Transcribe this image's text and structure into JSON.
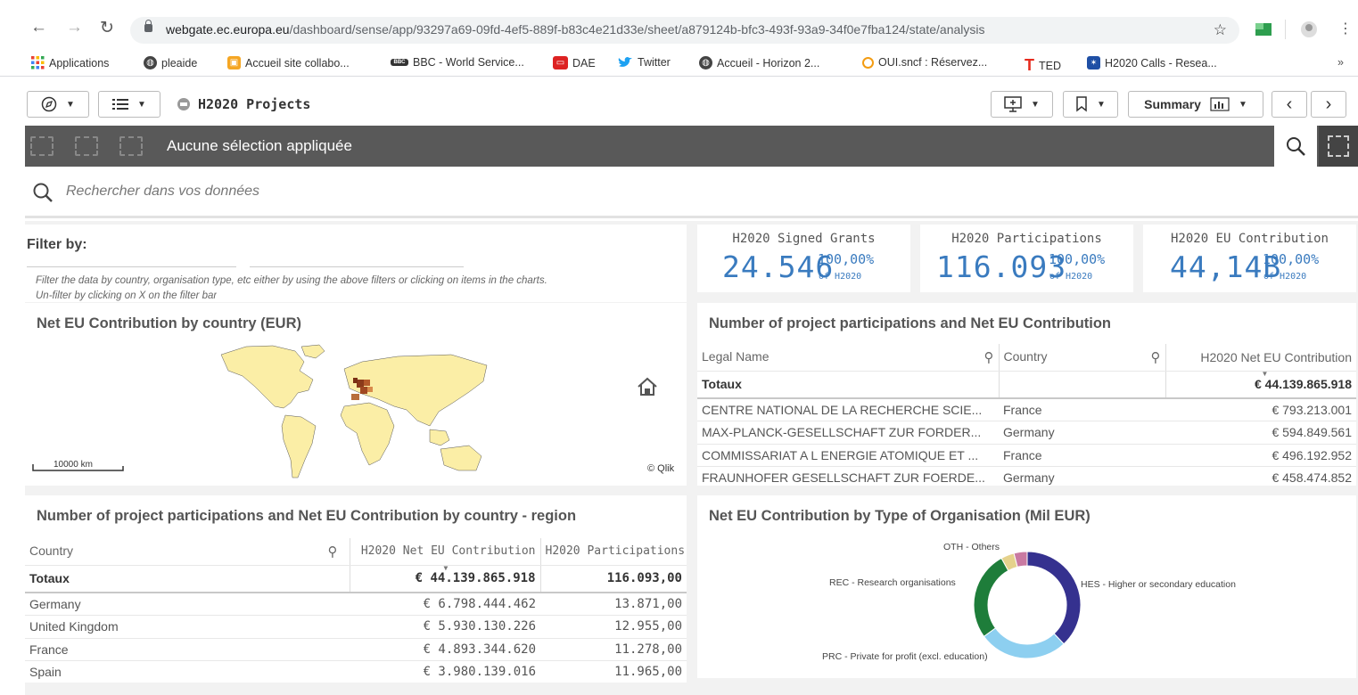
{
  "browser": {
    "url_domain": "webgate.ec.europa.eu",
    "url_path": "/dashboard/sense/app/93297a69-09fd-4ef5-889f-b83c4e21d33e/sheet/a879124b-bfc3-493f-93a9-34f0e7fba124/state/analysis",
    "bookmarks": [
      "Applications",
      "pleaide",
      "Accueil site collabo...",
      "BBC - World Service...",
      "DAE",
      "Twitter",
      "Accueil - Horizon 2...",
      "OUI.sncf : Réservez...",
      "TED",
      "H2020 Calls - Resea..."
    ],
    "bookmarks_more": "»"
  },
  "toolbar": {
    "app_title": "H2020 Projects",
    "sheet_label": "Summary"
  },
  "selections": {
    "text": "Aucune sélection appliquée"
  },
  "search": {
    "placeholder": "Rechercher dans vos données"
  },
  "filter": {
    "title": "Filter by:",
    "hint_line1": "Filter the data by country, organisation type, etc either by using the above filters or clicking on items in the charts.",
    "hint_line2": "Un-filter by clicking on X on the filter bar"
  },
  "kpis": [
    {
      "label": "H2020 Signed Grants",
      "value": "24.546",
      "pct": "100,00%",
      "of": "of H2020"
    },
    {
      "label": "H2020 Participations",
      "value": "116.093",
      "pct": "100,00%",
      "of": "of H2020"
    },
    {
      "label": "H2020 EU Contribution",
      "value": "44,14B",
      "pct": "100,00%",
      "of": "of H2020"
    }
  ],
  "map": {
    "title": "Net EU Contribution by country (EUR)",
    "scale": "10000 km",
    "credit": "© Qlik"
  },
  "participants_table": {
    "title": "Number of project participations and Net EU Contribution",
    "columns": [
      "Legal Name",
      "Country",
      "H2020 Net EU Contribution"
    ],
    "totals_label": "Totaux",
    "totals_value": "€ 44.139.865.918",
    "rows": [
      [
        "CENTRE NATIONAL DE LA RECHERCHE SCIE...",
        "France",
        "€ 793.213.001"
      ],
      [
        "MAX-PLANCK-GESELLSCHAFT ZUR FORDER...",
        "Germany",
        "€ 594.849.561"
      ],
      [
        "COMMISSARIAT A L ENERGIE ATOMIQUE ET ...",
        "France",
        "€ 496.192.952"
      ],
      [
        "FRAUNHOFER GESELLSCHAFT ZUR FOERDE...",
        "Germany",
        "€ 458.474.852"
      ]
    ]
  },
  "country_table": {
    "title": "Number of project participations and Net EU Contribution by country - region",
    "columns": [
      "Country",
      "H2020 Net EU Contribution",
      "H2020 Participations"
    ],
    "totals_label": "Totaux",
    "totals_contribution": "€ 44.139.865.918",
    "totals_participations": "116.093,00",
    "rows": [
      [
        "Germany",
        "€ 6.798.444.462",
        "13.871,00"
      ],
      [
        "United Kingdom",
        "€ 5.930.130.226",
        "12.955,00"
      ],
      [
        "France",
        "€ 4.893.344.620",
        "11.278,00"
      ],
      [
        "Spain",
        "€ 3.980.139.016",
        "11.965,00"
      ]
    ]
  },
  "chart_data": {
    "type": "pie",
    "title": "Net EU Contribution by Type of Organisation (Mil EUR)",
    "donut": true,
    "slices": [
      {
        "label": "HES - Higher or secondary education",
        "value": 38,
        "color": "#35318f"
      },
      {
        "label": "PRC - Private for profit (excl. education)",
        "value": 27,
        "color": "#8dcff0"
      },
      {
        "label": "REC - Research organisations",
        "value": 27,
        "color": "#1e7d3a"
      },
      {
        "label": "",
        "value": 4,
        "color": "#e5d28c"
      },
      {
        "label": "OTH - Others",
        "value": 4,
        "color": "#c97aa2"
      }
    ]
  }
}
